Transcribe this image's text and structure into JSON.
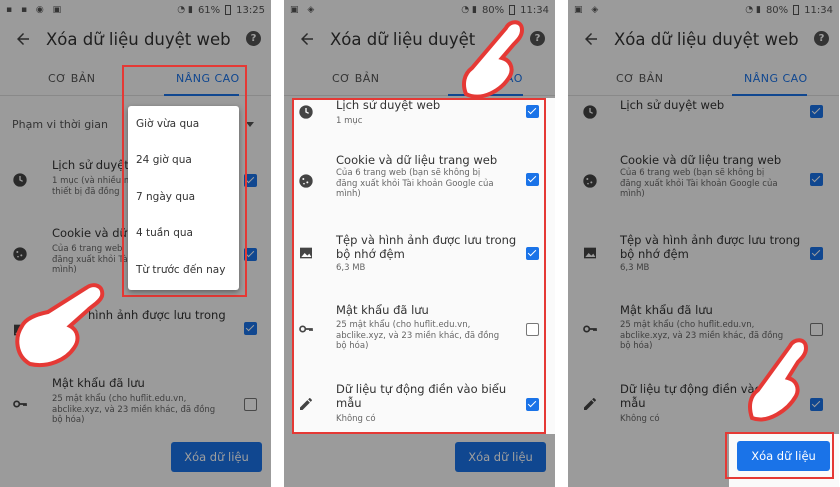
{
  "colors": {
    "accent": "#1a73e8",
    "highlight": "#e53935",
    "overlay": "rgba(0,0,0,0.38)"
  },
  "panel1": {
    "status": {
      "battery": "61%",
      "time": "13:25"
    },
    "title": "Xóa dữ liệu duyệt web",
    "tab_basic": "CƠ BẢN",
    "tab_advanced": "NÂNG CAO",
    "range_label": "Phạm vi thời gian",
    "items": [
      {
        "title": "Lịch sử duyệt w",
        "sub": "1 mục (và nhiều m\nthiết bị đã đồng",
        "icon": "clock-icon"
      },
      {
        "title": "Cookie và dữ li",
        "sub": "Của 6 trang web\nđăng xuất khỏi Tà\nmình)",
        "icon": "cookie-icon"
      },
      {
        "title": "hình ảnh được lưu trong",
        "icon": "image-icon"
      },
      {
        "title": "Mật khẩu đã lưu",
        "sub": "25 mật khẩu (cho huflit.edu.vn,\nabclike.xyz, và 23 miền khác, đã đồng\nbộ hóa)",
        "icon": "key-icon"
      }
    ],
    "menu": [
      "Giờ vừa qua",
      "24 giờ qua",
      "7 ngày qua",
      "4 tuần qua",
      "Từ trước đến nay"
    ],
    "clear_button": "Xóa dữ liệu"
  },
  "panel2": {
    "status": {
      "battery": "80%",
      "time": "11:34"
    },
    "title": "Xóa dữ liệu duyệt",
    "tab_basic": "CƠ BẢN",
    "tab_advanced": "NG CAO",
    "items": [
      {
        "title": "Lịch sử duyệt web",
        "sub": "1 mục",
        "checked": true,
        "icon": "clock-icon"
      },
      {
        "title": "Cookie và dữ liệu trang web",
        "sub": "Của 6 trang web (bạn sẽ không bị\nđăng xuất khỏi Tài khoản Google của\nmình)",
        "checked": true,
        "icon": "cookie-icon"
      },
      {
        "title": "Tệp và hình ảnh được lưu trong\nbộ nhớ đệm",
        "sub": "6,3 MB",
        "checked": true,
        "icon": "image-icon"
      },
      {
        "title": "Mật khẩu đã lưu",
        "sub": "25 mật khẩu (cho huflit.edu.vn,\nabclike.xyz, và 23 miền khác, đã đồng\nbộ hóa)",
        "checked": false,
        "icon": "key-icon"
      },
      {
        "title": "Dữ liệu tự động điền vào biểu\nmẫu",
        "sub": "Không có",
        "checked": true,
        "icon": "pencil-icon"
      }
    ],
    "clear_button": "Xóa dữ liệu"
  },
  "panel3": {
    "status": {
      "battery": "80%",
      "time": "11:34"
    },
    "title": "Xóa dữ liệu duyệt web",
    "tab_basic": "CƠ BẢN",
    "tab_advanced": "NÂNG CAO",
    "items": [
      {
        "title": "Lịch sử duyệt web",
        "sub": "",
        "checked": true,
        "icon": "clock-icon"
      },
      {
        "title": "Cookie và dữ liệu trang web",
        "sub": "Của 6 trang web (bạn sẽ không bị\nđăng xuất khỏi Tài khoản Google của\nmình)",
        "checked": true,
        "icon": "cookie-icon"
      },
      {
        "title": "Tệp và hình ảnh được lưu trong\nbộ nhớ đệm",
        "sub": "6,3 MB",
        "checked": true,
        "icon": "image-icon"
      },
      {
        "title": "Mật khẩu đã lưu",
        "sub": "25 mật khẩu (cho huflit.edu.vn,\nabclike.xyz, và 23 miền khác, đã đồng\nbộ hóa)",
        "checked": false,
        "icon": "key-icon"
      },
      {
        "title": "Dữ liệu tự động điền vào bi\nmẫu",
        "sub": "Không có",
        "checked": true,
        "icon": "pencil-icon"
      }
    ],
    "clear_button": "Xóa dữ liệu"
  }
}
